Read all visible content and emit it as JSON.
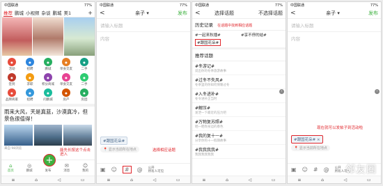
{
  "status": {
    "carrier": "中国联通",
    "signal": " ",
    "battery": "77%",
    "time": "下午"
  },
  "p1": {
    "tabs": [
      "推荐",
      "鹏城",
      "小视频",
      "杂谈",
      "鹏城",
      "美1"
    ],
    "grid": [
      {
        "label": "活动",
        "color": "#e74c3c"
      },
      {
        "label": "招聘",
        "color": "#2e86de"
      },
      {
        "label": "鹏城",
        "color": "#27ae60"
      },
      {
        "label": "单身交友",
        "color": "#e67e22"
      },
      {
        "label": "二手",
        "color": "#16a085"
      },
      {
        "label": "签到",
        "color": "#c0392b"
      },
      {
        "label": "求职",
        "color": "#f39c12"
      },
      {
        "label": "积分商城",
        "color": "#8e44ad"
      },
      {
        "label": "单身交友",
        "color": "#e84393"
      },
      {
        "label": "二手",
        "color": "#2ecc71"
      },
      {
        "label": "品牌商家",
        "color": "#e74c3c"
      },
      {
        "label": "招聘",
        "color": "#3498db"
      },
      {
        "label": "问鹏城",
        "color": "#1abc9c"
      },
      {
        "label": "房产",
        "color": "#d35400"
      },
      {
        "label": "房团",
        "color": "#27ae60"
      }
    ],
    "post": "雨来大风，天是真蓝，沙漠真冷，但景色很值得！",
    "meta": "来自 98浏览",
    "nav": [
      {
        "icon": "⌂",
        "label": "首页"
      },
      {
        "icon": "◎",
        "label": "鹏城"
      },
      {
        "icon": "",
        "label": "发布"
      },
      {
        "icon": "✉",
        "label": "消息"
      },
      {
        "icon": "☺",
        "label": "我的"
      }
    ],
    "annotation": "能先长按这个点击进入",
    "fab": "+"
  },
  "p2": {
    "back": "<",
    "title": "亲子 ▾",
    "publish": "发布",
    "title_placeholder": "请输入标题",
    "body_placeholder": "内容",
    "chip": "#跟国花朵#",
    "location": "📍 显示当前所在地点",
    "toolbar": [
      "▣",
      "☺",
      "#",
      "@"
    ],
    "visibility": "公开\n所有人可见",
    "annotation": "选择相应话题"
  },
  "p3": {
    "back": "<",
    "title": "选择话题",
    "cancel": "不选择话题",
    "history_header": "历史记录",
    "history_annotation": "在话题中找到相应话题",
    "history": [
      "#一起来秋播#",
      "#享不停的结#",
      "#跟国花朵#"
    ],
    "rec_header": "推荐话题",
    "recommended": [
      {
        "t": "#冬游记#",
        "s": "说出你的冬季旅游故事"
      },
      {
        "t": "#过冬不失风#",
        "s": "冬季里的你如何保暖过冬"
      },
      {
        "t": "#入冬进补#",
        "s": "冬令进补正当时"
      },
      {
        "t": "#解压#",
        "s": "发泄一下最近的压力吧"
      },
      {
        "t": "#万物复苏照#",
        "s": "晒一晒你身边的春色"
      },
      {
        "t": "#我的复十一#",
        "s": "分享你的十一假期故事"
      },
      {
        "t": "#我我我我#",
        "s": "我我我我我我"
      }
    ]
  },
  "p4": {
    "back": "<",
    "title": "亲子 ▾",
    "publish": "发布",
    "title_placeholder": "请输入标题",
    "body_placeholder": "内容",
    "chip": "#跟国花朵#",
    "location": "📍 显示当前所在地点",
    "toolbar": [
      "▣",
      "☺",
      "#",
      "@"
    ],
    "visibility": "公开\n所有人可见",
    "annotation": "现在就可以发帖子到活动啦",
    "watermark": "邻友圈"
  },
  "sysbar": [
    "≡",
    "⌂",
    "◁",
    "▭"
  ]
}
